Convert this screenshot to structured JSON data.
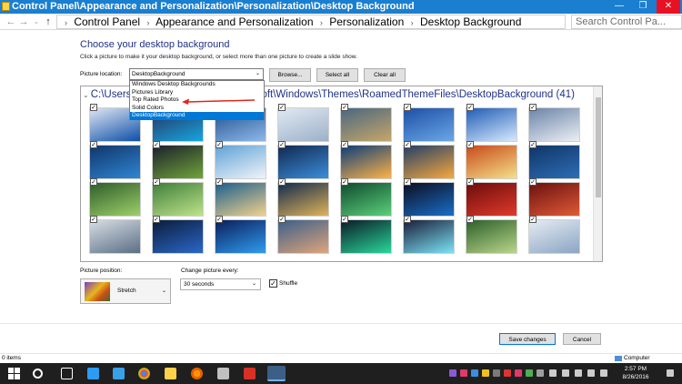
{
  "window": {
    "title": "Control Panel\\Appearance and Personalization\\Personalization\\Desktop Background",
    "controls": {
      "minimize": "—",
      "maximize": "❐",
      "close": "✕"
    }
  },
  "address": {
    "back": "←",
    "forward": "→",
    "up": "↑",
    "crumbs": [
      "Control Panel",
      "Appearance and Personalization",
      "Personalization",
      "Desktop Background"
    ],
    "search_placeholder": "Search Control Pa..."
  },
  "main": {
    "heading": "Choose your desktop background",
    "subtitle": "Click a picture to make it your desktop background, or select more than one picture to create a slide show.",
    "picture_location_label": "Picture location:",
    "picture_location_value": "DesktopBackground",
    "browse_label": "Browse...",
    "select_all_label": "Select all",
    "clear_all_label": "Clear all",
    "location_options": [
      "Windows Desktop Backgrounds",
      "Pictures Library",
      "Top Rated Photos",
      "Solid Colors",
      "DesktopBackground"
    ],
    "selected_option_index": 4,
    "folder_title": "C:\\Users\\...oft\\Windows\\Themes\\RoamedThemeFiles\\DesktopBackground (41)",
    "folder_visible_start": "C:\\Users",
    "folder_visible_end": "oft\\Windows\\Themes\\RoamedThemeFiles\\DesktopBackground (41)",
    "thumbnails_checked": true
  },
  "thumbnails": [
    [
      "#dfe6f2",
      "#0d4fa8"
    ],
    [
      "#2a2e5c",
      "#16a6e0"
    ],
    [
      "#1d4f8c",
      "#8fb8e8"
    ],
    [
      "#e0e9f2",
      "#9cb1c8"
    ],
    [
      "#4a6780",
      "#c6a66a"
    ],
    [
      "#1e4fa6",
      "#6aa7e6"
    ],
    [
      "#1f5db3",
      "#d7e9ff"
    ],
    [
      "#6b84a8",
      "#eceff4"
    ],
    [
      "#11356a",
      "#2e86d3"
    ],
    [
      "#1a1f2c",
      "#71a43a"
    ],
    [
      "#5fa2d7",
      "#f0f4f8"
    ],
    [
      "#12284f",
      "#3a8edb"
    ],
    [
      "#0a3d7a",
      "#ffb347"
    ],
    [
      "#223f6a",
      "#f7a83d"
    ],
    [
      "#c84a1a",
      "#f4e08a"
    ],
    [
      "#0f3566",
      "#2e6db5"
    ],
    [
      "#2e5d2b",
      "#9ecf68"
    ],
    [
      "#3f7f3a",
      "#bfe38a"
    ],
    [
      "#1a5f8e",
      "#f2d18c"
    ],
    [
      "#112a4d",
      "#e0b35a"
    ],
    [
      "#0f4a2e",
      "#5bd07a"
    ],
    [
      "#0c0e1e",
      "#1a6ec9"
    ],
    [
      "#6b0c0c",
      "#e03a2a"
    ],
    [
      "#6a1010",
      "#e05a36"
    ],
    [
      "#d8dde4",
      "#5a6f85"
    ],
    [
      "#0c1c3a",
      "#2a68c9"
    ],
    [
      "#0b1e5a",
      "#2f9cf0"
    ],
    [
      "#3a5f8a",
      "#e0a47a"
    ],
    [
      "#0a1a26",
      "#2ad79a"
    ],
    [
      "#1b1d3a",
      "#7be3f5"
    ],
    [
      "#2d5f2a",
      "#b9d68a"
    ],
    [
      "#e6ebf2",
      "#8aa5c4"
    ]
  ],
  "options": {
    "position_label": "Picture position:",
    "position_value": "Stretch",
    "change_label": "Change picture every:",
    "change_value": "30 seconds",
    "shuffle_label": "Shuffle",
    "shuffle_checked": true
  },
  "footer": {
    "save_label": "Save changes",
    "cancel_label": "Cancel"
  },
  "status": {
    "items": "0 items",
    "computer": "Computer"
  },
  "taskbar": {
    "time": "2:57 PM",
    "date": "8/26/2016"
  },
  "colors": {
    "titlebar": "#1b7fd0",
    "accent": "#0078d7",
    "heading": "#1e3287",
    "taskbar": "#1f1f1f"
  }
}
